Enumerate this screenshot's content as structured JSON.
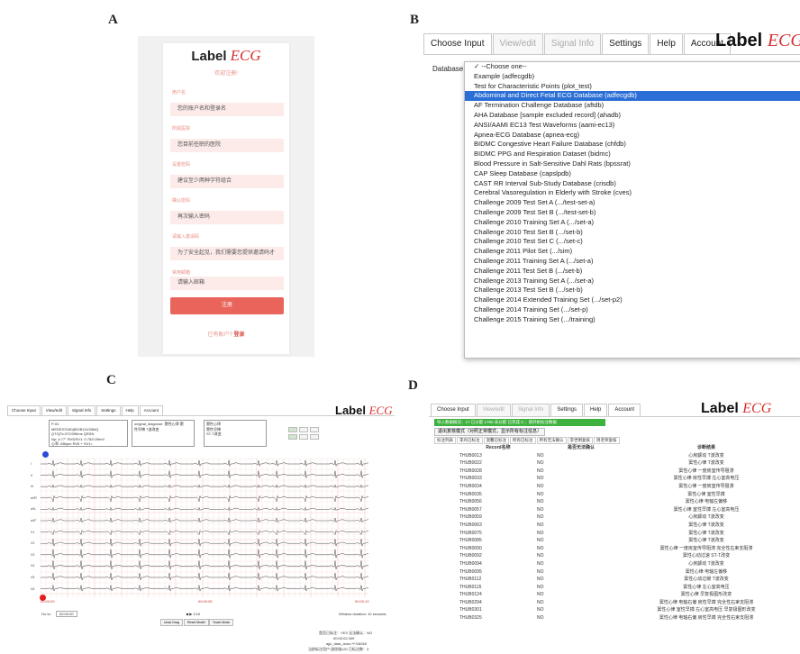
{
  "labels": {
    "a": "A",
    "b": "B",
    "c": "C",
    "d": "D"
  },
  "brand": {
    "label": "Label",
    "ecg": "ECG",
    "accent": "#d62f2f"
  },
  "panel_a": {
    "subtitle": "欢迎注册!",
    "fields": [
      {
        "label": "用户名",
        "placeholder": "您的账户名和登录名"
      },
      {
        "label": "所属医院",
        "placeholder": "您目前任职的医院"
      },
      {
        "label": "设置密码",
        "placeholder": "建议至少两种字符组合"
      },
      {
        "label": "确认密码",
        "placeholder": "再次输入密码"
      },
      {
        "label": "请输入邀请码",
        "placeholder": "为了安全起见，我们需要您提供邀请码才"
      },
      {
        "label": "常用邮箱",
        "placeholder": "请输入邮箱"
      }
    ],
    "register_button": "注册",
    "footer_text": "已有账户?",
    "footer_link": "登录"
  },
  "panel_b": {
    "tabs": [
      "Choose Input",
      "View/edit",
      "Signal Info",
      "Settings",
      "Help",
      "Account"
    ],
    "database_label": "Database",
    "options": [
      "✓ --Choose one--",
      "Example (adfecgdb)",
      "Test for Characteristic Points (plot_test)",
      "Abdominal and Direct Fetal ECG Database (adfecgdb)",
      "AF Termination Challenge Database (aftdb)",
      "AHA Database [sample excluded record] (ahadb)",
      "ANSI/AAMI EC13 Test Waveforms (aami-ec13)",
      "Apnea-ECG Database (apnea-ecg)",
      "BIDMC Congestive Heart Failure Database (chfdb)",
      "BIDMC PPG and Respiration Dataset (bidmc)",
      "Blood Pressure in Salt-Sensitive Dahl Rats (bpssrat)",
      "CAP Sleep Database (capslpdb)",
      "CAST RR Interval Sub-Study Database (crisdb)",
      "Cerebral Vasoregulation in Elderly with Stroke (cves)",
      "Challenge 2009 Test Set A (.../test-set-a)",
      "Challenge 2009 Test Set B (.../test-set-b)",
      "Challenge 2010 Training Set A (.../set-a)",
      "Challenge 2010 Test Set B (.../set-b)",
      "Challenge 2010 Test Set C (.../set-c)",
      "Challenge 2011 Pilot Set (.../sim)",
      "Challenge 2011 Training Set A (.../set-a)",
      "Challenge 2011 Test Set B (.../set-b)",
      "Challenge 2013 Training Set A (.../set-a)",
      "Challenge 2013 Test Set B (.../set-b)",
      "Challenge 2014 Extended Training Set (.../set-p2)",
      "Challenge 2014 Training Set (.../set-p)",
      "Challenge 2015 Training Set (.../training)"
    ],
    "selected_index": 3
  },
  "panel_c": {
    "tabs": [
      "Choose Input",
      "View/edit",
      "Signal Info",
      "Settings",
      "Help",
      "Account"
    ],
    "info_box_1": "P-51\nMEDEXS180(802B1110384Q\nQT/QTc:372/396ms QRSN\nNp: a 77° RV5/SV1: 0.75/0.09mV\n心率: 68bpm RV5 + SV1=",
    "info_box_2": "original_diagnose: 窦性心律 窦\n性早搏 T波改变",
    "info_box_3": "窦性心律\n窦性早搏\nST-T改变",
    "lead_labels": [
      "I",
      "II",
      "III",
      "aVR",
      "aVL",
      "aVF",
      "V1",
      "V2",
      "V3",
      "V4",
      "V5",
      "V6"
    ],
    "time_start": "00:00:00",
    "time_mid": "00:00:05",
    "time_end": "00:00:10",
    "go_to_label": "Go to:",
    "go_to_value": "00:00:00",
    "buttons": [
      "Undo Drag",
      "Reset Model",
      "Touch Mode"
    ],
    "status_lines": [
      "是否已标注：YES  无法确认：NO",
      "00:00:02.349",
      "ajpi_data_anno:*/*/18269",
      "当前标注用户:游欣瑞120 已标注数：3"
    ],
    "scale_text": "Window duration: 10 seconds",
    "page_nav": "◀ ▶  1/10"
  },
  "panel_d": {
    "tabs": [
      "Choose Input",
      "View/edit",
      "Signal Info",
      "Settings",
      "Help",
      "Account"
    ],
    "banner": "导入数据概况：17 已分配 1760 未分配 已完成 0 ；请开始标注数据",
    "exit_button": "退出复核模式（对照正常模式，显示所有标注信息）",
    "subtabs": [
      "标注列表",
      "李丹已标注",
      "温馨已标注",
      "所有已标注",
      "所有无法确认",
      "李世明复核",
      "周老师复核"
    ],
    "columns": [
      "Record名称",
      "是否无法确认",
      "诊断结果"
    ],
    "rows": [
      [
        "THUB0013",
        "NO",
        "心房颤动 T波改变"
      ],
      [
        "THUB0022",
        "NO",
        "窦性心律 T波改变"
      ],
      [
        "THUB0028",
        "NO",
        "窦性心律 一度房室传导阻滞"
      ],
      [
        "THUB0033",
        "NO",
        "窦性心律 房性早搏 左心室高电压"
      ],
      [
        "THUB0034",
        "NO",
        "窦性心律 一度房室传导阻滞"
      ],
      [
        "THUB0035",
        "NO",
        "窦性心律 室性早搏"
      ],
      [
        "THUB0056",
        "NO",
        "窦性心律 电轴左偏移"
      ],
      [
        "THUB0057",
        "NO",
        "窦性心律 室性早搏 左心室高电压"
      ],
      [
        "THUB0059",
        "NO",
        "心房颤动 T波改变"
      ],
      [
        "THUB0063",
        "NO",
        "窦性心律 T波改变"
      ],
      [
        "THUB0075",
        "NO",
        "窦性心律 T波改变"
      ],
      [
        "THUB0085",
        "NO",
        "窦性心律 T波改变"
      ],
      [
        "THUB0090",
        "NO",
        "窦性心律 一度房室传导阻滞 完全性右束支阻滞"
      ],
      [
        "THUB0092",
        "NO",
        "窦性心动过速 ST-T改变"
      ],
      [
        "THUB0094",
        "NO",
        "心房颤动 T波改变"
      ],
      [
        "THUB0095",
        "NO",
        "窦性心律 电轴左偏移"
      ],
      [
        "THUB0112",
        "NO",
        "窦性心动过缓 T波改变"
      ],
      [
        "THUB0115",
        "NO",
        "窦性心律 左心室高电压"
      ],
      [
        "THUB0124",
        "NO",
        "窦性心律 早复极图形改变"
      ],
      [
        "THUB0294",
        "NO",
        "窦性心律 电轴右偏 房性早搏 完全性右束支阻滞"
      ],
      [
        "THUB0301",
        "NO",
        "窦性心律 室性早搏 左心室高电压 早复极图形改变"
      ],
      [
        "THUB0325",
        "NO",
        "窦性心律 电轴右偏 房性早搏 完全性右束支阻滞"
      ]
    ]
  }
}
